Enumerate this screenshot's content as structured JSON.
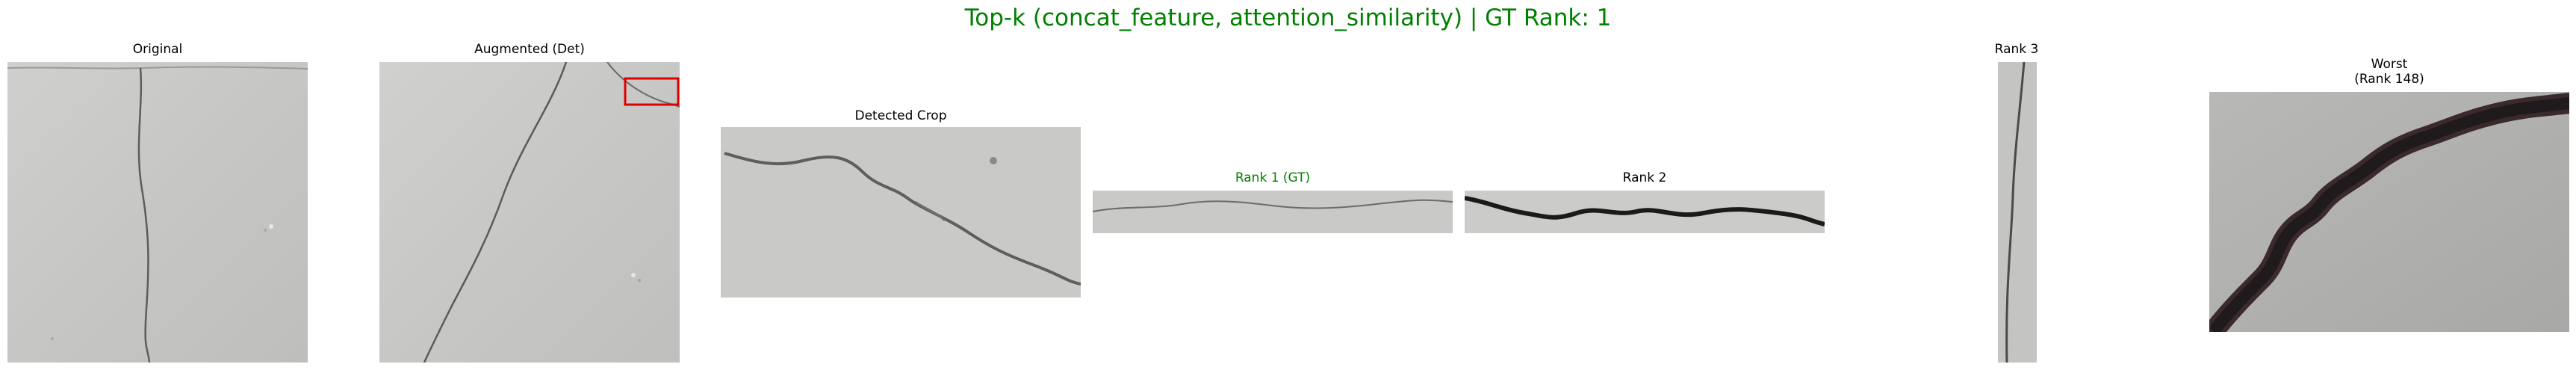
{
  "figure": {
    "title": "Top-k (concat_feature, attention_similarity) | GT Rank: 1",
    "title_color": "#008000"
  },
  "panels": {
    "original": {
      "title": "Original"
    },
    "augmented": {
      "title": "Augmented (Det)",
      "bbox_color": "#e00000"
    },
    "detected_crop": {
      "title": "Detected Crop"
    },
    "rank1": {
      "title": "Rank 1 (GT)",
      "title_color": "#008000"
    },
    "rank2": {
      "title": "Rank 2"
    },
    "rank3": {
      "title": "Rank 3"
    },
    "worst": {
      "title_line1": "Worst",
      "title_line2": "(Rank 148)"
    }
  }
}
